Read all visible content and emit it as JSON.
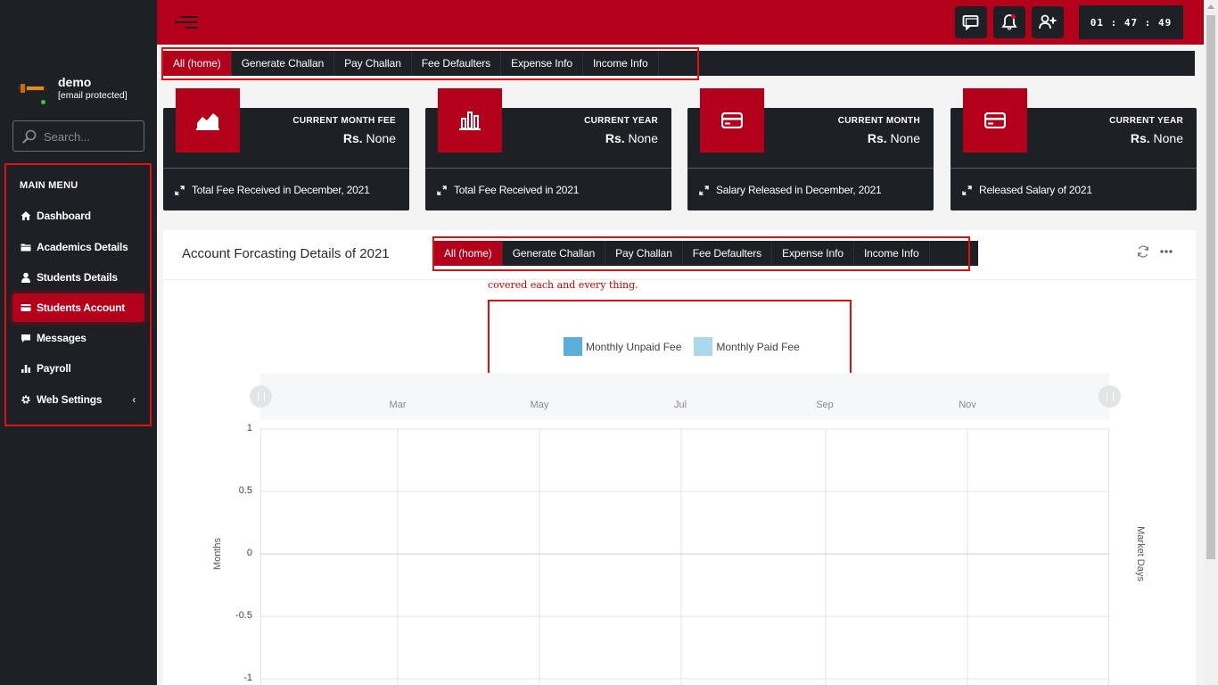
{
  "sidebar": {
    "user_name": "demo",
    "user_email": "[email protected]",
    "search_placeholder": "Search...",
    "menu_title": "MAIN MENU",
    "items": [
      {
        "label": "Dashboard",
        "icon": "home-icon"
      },
      {
        "label": "Academics Details",
        "icon": "folder-icon"
      },
      {
        "label": "Students Details",
        "icon": "user-icon"
      },
      {
        "label": "Students Account",
        "icon": "card-icon",
        "active": true
      },
      {
        "label": "Messages",
        "icon": "chat-icon"
      },
      {
        "label": "Payroll",
        "icon": "bar-chart-icon"
      },
      {
        "label": "Web Settings",
        "icon": "gear-icon"
      }
    ]
  },
  "topbar": {
    "clock": "01 : 47 : 49",
    "buttons": [
      "chat-icon",
      "bell-icon",
      "add-user-icon"
    ]
  },
  "tabs_top": [
    "All (home)",
    "Generate Challan",
    "Pay Challan",
    "Fee Defaulters",
    "Expense Info",
    "Income Info"
  ],
  "tabs_panel": [
    "All (home)",
    "Generate Challan",
    "Pay Challan",
    "Fee Defaulters",
    "Expense Info",
    "Income Info"
  ],
  "cards": [
    {
      "title": "CURRENT MONTH FEE",
      "currency": "Rs.",
      "value": "None",
      "footer": "Total Fee Received in December, 2021",
      "icon": "area-chart-icon"
    },
    {
      "title": "CURRENT YEAR",
      "currency": "Rs.",
      "value": "None",
      "footer": "Total Fee Received in 2021",
      "icon": "bar-chart-icon"
    },
    {
      "title": "CURRENT MONTH",
      "currency": "Rs.",
      "value": "None",
      "footer": "Salary Released in December, 2021",
      "icon": "credit-card-icon"
    },
    {
      "title": "CURRENT YEAR",
      "currency": "Rs.",
      "value": "None",
      "footer": "Released Salary of 2021",
      "icon": "credit-card-icon"
    }
  ],
  "panel": {
    "title": "Account Forcasting Details of 2021",
    "note": "covered each and every thing."
  },
  "colors": {
    "brand_red": "#b3001b",
    "dark": "#1d2024",
    "highlight_border": "#e01010"
  },
  "chart_data": {
    "type": "bar",
    "title": "",
    "series": [
      {
        "name": "Monthly Unpaid Fee",
        "color": "#5aafdd",
        "values": []
      },
      {
        "name": "Monthly Paid Fee",
        "color": "#acd8ee",
        "values": []
      }
    ],
    "navigator_labels": [
      "Mar",
      "May",
      "Jul",
      "Sep",
      "Nov"
    ],
    "ylabel": "Months",
    "y2label": "Market Days",
    "yticks": [
      "1",
      "0.5",
      "0",
      "-0.5",
      "-1"
    ],
    "ylim": [
      -1,
      1
    ],
    "grid": true
  }
}
